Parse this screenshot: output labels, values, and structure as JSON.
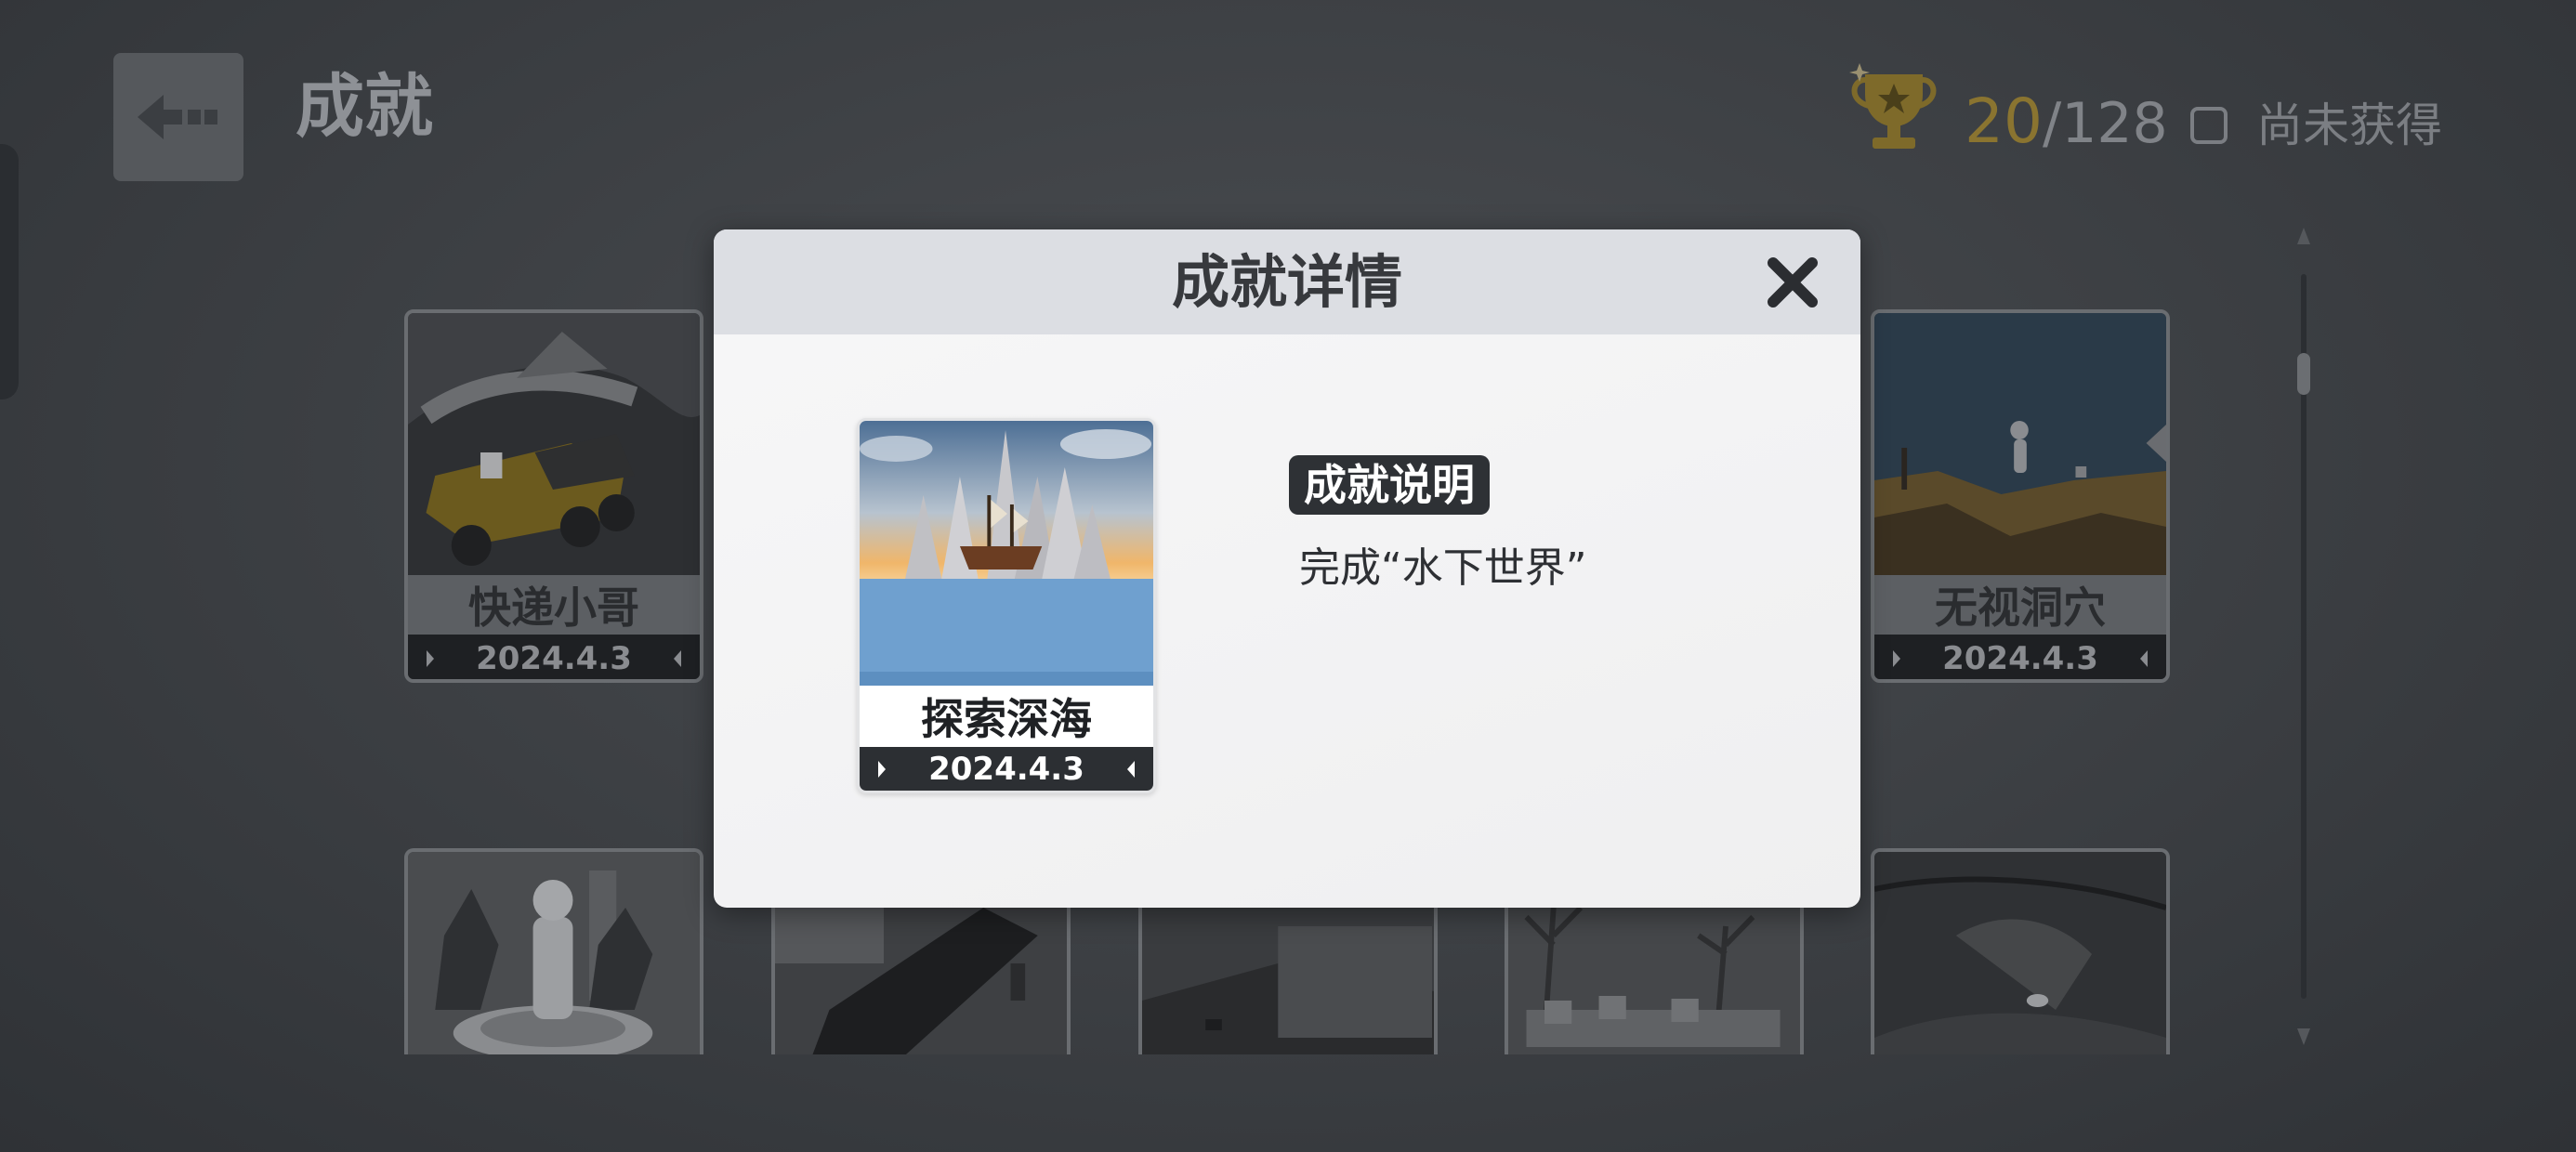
{
  "header": {
    "title": "成就",
    "back_icon": "back-arrow-icon",
    "progress": {
      "unlocked": "20",
      "total": "/128"
    },
    "filter_label": "尚未获得",
    "filter_checked": false
  },
  "achievements": [
    {
      "name": "快递小哥",
      "date": "2024.4.3"
    },
    {
      "name": "无视洞穴",
      "date": "2024.4.3"
    }
  ],
  "modal": {
    "title": "成就详情",
    "close_icon": "close-icon",
    "card": {
      "name": "探索深海",
      "date": "2024.4.3"
    },
    "desc_label": "成就说明",
    "desc_text": "完成“水下世界”"
  },
  "colors": {
    "trophy_gold": "#9a7f2c",
    "modal_bg": "#f2f2f3",
    "badge_bg": "#2e3135"
  }
}
